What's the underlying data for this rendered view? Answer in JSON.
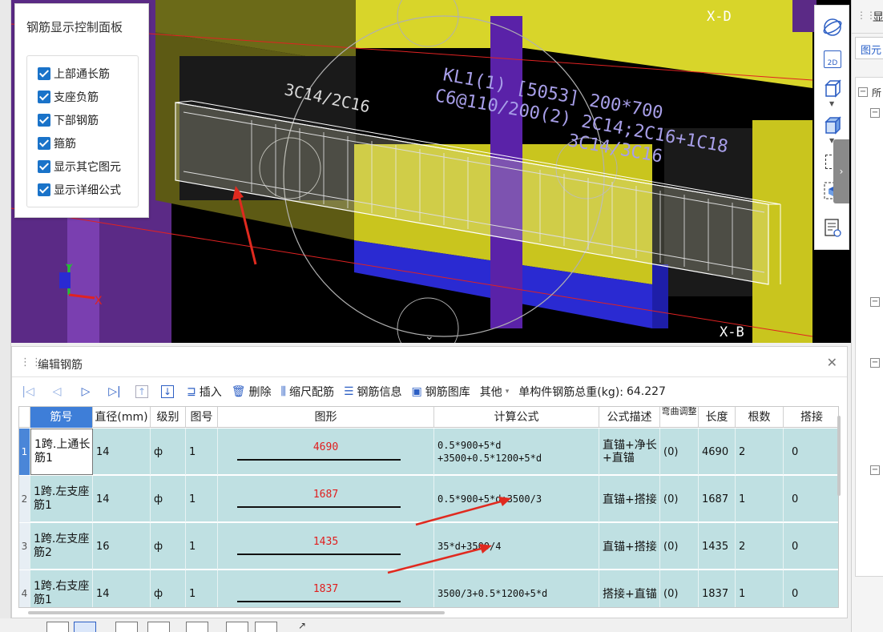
{
  "viewport": {
    "beam_label_1": "KL1(1) [5053] 200*700",
    "beam_label_2": "C6@110/200(2) 2C14;2C16+1C18",
    "beam_label_3": "3C14/3C16",
    "span_label": "3C14/2C16",
    "axis_top": "X-D",
    "axis_bottom": "X-B",
    "axis_x": "X",
    "axis_y": "Y"
  },
  "control_panel": {
    "title": "钢筋显示控制面板",
    "options": [
      {
        "label": "上部通长筋",
        "checked": true
      },
      {
        "label": "支座负筋",
        "checked": true
      },
      {
        "label": "下部钢筋",
        "checked": true
      },
      {
        "label": "箍筋",
        "checked": true
      },
      {
        "label": "显示其它图元",
        "checked": true
      },
      {
        "label": "显示详细公式",
        "checked": true
      }
    ]
  },
  "right_toolbar": {
    "icons": [
      "orbit-icon",
      "2d-view-icon",
      "3d-box-icon",
      "solid-box-icon",
      "select-box-icon",
      "shade-icon",
      "list-view-icon"
    ],
    "label_2d": "2D"
  },
  "right_panel": {
    "header": "显",
    "tab": "图元",
    "tree_first": "所"
  },
  "edit_panel": {
    "title": "编辑钢筋",
    "toolbar": {
      "insert": "插入",
      "delete": "删除",
      "scale_config": "缩尺配筋",
      "rebar_info": "钢筋信息",
      "rebar_library": "钢筋图库",
      "other": "其他",
      "total_weight_label": "单构件钢筋总重(kg):",
      "total_weight_value": "64.227"
    },
    "columns": [
      "筋号",
      "直径(mm)",
      "级别",
      "图号",
      "图形",
      "计算公式",
      "公式描述",
      "弯曲调整",
      "长度",
      "根数",
      "搭接"
    ],
    "rows": [
      {
        "num": "1",
        "name": "1跨.上通长筋1",
        "dia": "14",
        "grade": "ф",
        "fig": "1",
        "shape": "4690",
        "formula1": "0.5*900+5*d",
        "formula2": "+3500+0.5*1200+5*d",
        "desc": "直锚+净长+直锚",
        "bend": "(0)",
        "length": "4690",
        "count": "2",
        "lap": "0"
      },
      {
        "num": "2",
        "name": "1跨.左支座筋1",
        "dia": "14",
        "grade": "ф",
        "fig": "1",
        "shape": "1687",
        "formula1": "0.5*900+5*d+3500/3",
        "formula2": "",
        "desc": "直锚+搭接",
        "bend": "(0)",
        "length": "1687",
        "count": "1",
        "lap": "0"
      },
      {
        "num": "3",
        "name": "1跨.左支座筋2",
        "dia": "16",
        "grade": "ф",
        "fig": "1",
        "shape": "1435",
        "formula1": "35*d+3500/4",
        "formula2": "",
        "desc": "直锚+搭接",
        "bend": "(0)",
        "length": "1435",
        "count": "2",
        "lap": "0"
      },
      {
        "num": "4",
        "name": "1跨.右支座筋1",
        "dia": "14",
        "grade": "ф",
        "fig": "1",
        "shape": "1837",
        "formula1": "3500/3+0.5*1200+5*d",
        "formula2": "",
        "desc": "搭接+直锚",
        "bend": "(0)",
        "length": "1837",
        "count": "1",
        "lap": "0"
      }
    ]
  }
}
